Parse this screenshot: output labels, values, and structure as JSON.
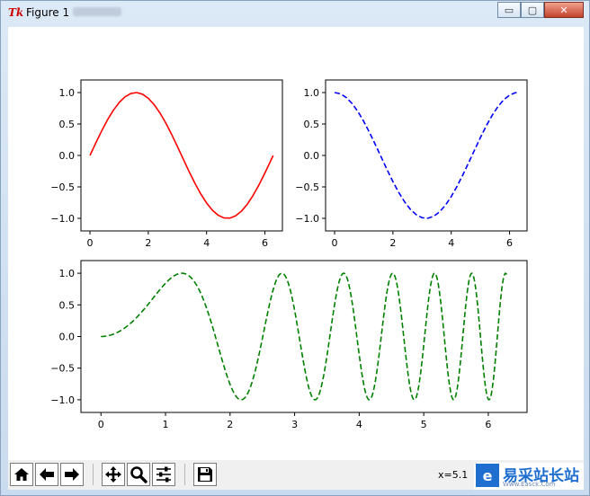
{
  "window": {
    "title": "Figure 1",
    "controls": {
      "minimize": "▭",
      "maximize": "▢",
      "close": "✕"
    }
  },
  "toolbar": {
    "buttons": [
      "home-icon",
      "back-icon",
      "forward-icon",
      "pan-icon",
      "zoom-icon",
      "configure-subplots-icon",
      "save-icon"
    ],
    "coordinate_readout": "x=5.1",
    "watermark": {
      "text": "易采站长站",
      "sub": "Www.Easck.Com"
    }
  },
  "chart_data": [
    {
      "type": "line",
      "function": "sin(x)",
      "style": "solid",
      "color": "#ff0000",
      "xlim": [
        -0.31,
        6.6
      ],
      "ylim": [
        -1.2,
        1.2
      ],
      "xticks": [
        0,
        2,
        4,
        6
      ],
      "yticks": [
        -1.0,
        -0.5,
        0.0,
        0.5,
        1.0
      ],
      "xtick_labels": [
        "0",
        "2",
        "4",
        "6"
      ],
      "ytick_labels": [
        "−1.0",
        "−0.5",
        "0.0",
        "0.5",
        "1.0"
      ],
      "x": [
        0,
        0.2,
        0.4,
        0.6,
        0.8,
        1.0,
        1.2,
        1.4,
        1.6,
        1.8,
        2.0,
        2.2,
        2.4,
        2.6,
        2.8,
        3.0,
        3.2,
        3.4,
        3.6,
        3.8,
        4.0,
        4.2,
        4.4,
        4.6,
        4.8,
        5.0,
        5.2,
        5.4,
        5.6,
        5.8,
        6.0,
        6.2,
        6.283
      ],
      "y": [
        0.0,
        0.199,
        0.389,
        0.565,
        0.717,
        0.841,
        0.932,
        0.985,
        1.0,
        0.974,
        0.909,
        0.808,
        0.675,
        0.516,
        0.335,
        0.141,
        -0.058,
        -0.256,
        -0.443,
        -0.612,
        -0.757,
        -0.872,
        -0.952,
        -0.994,
        -0.996,
        -0.959,
        -0.883,
        -0.773,
        -0.631,
        -0.465,
        -0.279,
        -0.083,
        0.0
      ]
    },
    {
      "type": "line",
      "function": "cos(x)",
      "style": "dashed",
      "color": "#0000ff",
      "xlim": [
        -0.31,
        6.6
      ],
      "ylim": [
        -1.2,
        1.2
      ],
      "xticks": [
        0,
        2,
        4,
        6
      ],
      "yticks": [
        -1.0,
        -0.5,
        0.0,
        0.5,
        1.0
      ],
      "xtick_labels": [
        "0",
        "2",
        "4",
        "6"
      ],
      "ytick_labels": [
        "−1.0",
        "−0.5",
        "0.0",
        "0.5",
        "1.0"
      ],
      "x": [
        0,
        0.2,
        0.4,
        0.6,
        0.8,
        1.0,
        1.2,
        1.4,
        1.6,
        1.8,
        2.0,
        2.2,
        2.4,
        2.6,
        2.8,
        3.0,
        3.2,
        3.4,
        3.6,
        3.8,
        4.0,
        4.2,
        4.4,
        4.6,
        4.8,
        5.0,
        5.2,
        5.4,
        5.6,
        5.8,
        6.0,
        6.2,
        6.283
      ],
      "y": [
        1.0,
        0.98,
        0.921,
        0.825,
        0.697,
        0.54,
        0.362,
        0.17,
        -0.029,
        -0.227,
        -0.416,
        -0.589,
        -0.737,
        -0.857,
        -0.942,
        -0.99,
        -0.998,
        -0.967,
        -0.897,
        -0.791,
        -0.654,
        -0.49,
        -0.307,
        -0.112,
        0.087,
        0.284,
        0.469,
        0.635,
        0.776,
        0.886,
        0.96,
        0.997,
        1.0
      ]
    },
    {
      "type": "line",
      "function": "sin(x^2)",
      "style": "dashed",
      "color": "#008000",
      "xlim": [
        -0.31,
        6.6
      ],
      "ylim": [
        -1.2,
        1.2
      ],
      "xticks": [
        0,
        1,
        2,
        3,
        4,
        5,
        6
      ],
      "yticks": [
        -1.0,
        -0.5,
        0.0,
        0.5,
        1.0
      ],
      "xtick_labels": [
        "0",
        "1",
        "2",
        "3",
        "4",
        "5",
        "6"
      ],
      "ytick_labels": [
        "−1.0",
        "−0.5",
        "0.0",
        "0.5",
        "1.0"
      ],
      "x_range": [
        0,
        6.283
      ],
      "samples": 600
    }
  ]
}
